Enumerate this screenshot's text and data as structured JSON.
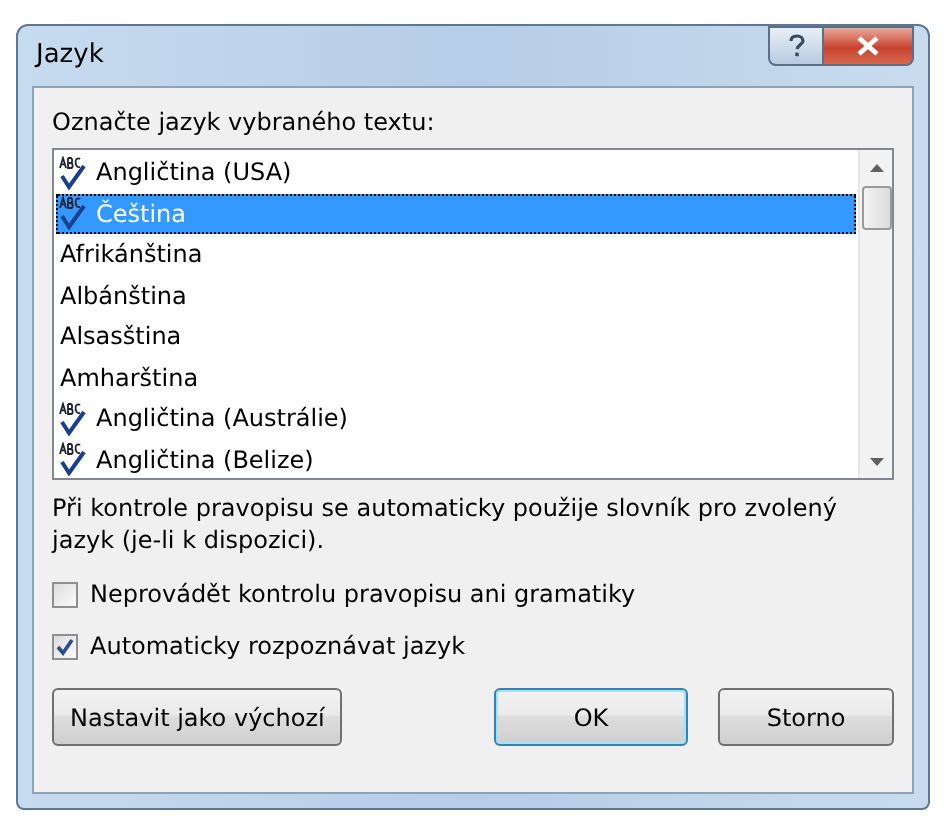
{
  "window": {
    "title": "Jazyk"
  },
  "list_label": "Označte jazyk vybraného textu:",
  "languages": [
    {
      "label": "Angličtina (USA)",
      "proofing": true,
      "selected": false
    },
    {
      "label": "Čeština",
      "proofing": true,
      "selected": true
    },
    {
      "label": "Afrikánština",
      "proofing": false,
      "selected": false
    },
    {
      "label": "Albánština",
      "proofing": false,
      "selected": false
    },
    {
      "label": "Alsasština",
      "proofing": false,
      "selected": false
    },
    {
      "label": "Amharština",
      "proofing": false,
      "selected": false
    },
    {
      "label": "Angličtina (Austrálie)",
      "proofing": true,
      "selected": false
    },
    {
      "label": "Angličtina (Belize)",
      "proofing": true,
      "selected": false
    }
  ],
  "note": "Při kontrole pravopisu se automaticky použije slovník pro zvolený jazyk (je-li k dispozici).",
  "options": [
    {
      "label": "Neprovádět kontrolu pravopisu ani gramatiky",
      "checked": false
    },
    {
      "label": "Automaticky rozpoznávat jazyk",
      "checked": true
    }
  ],
  "buttons": [
    {
      "label": "Nastavit jako výchozí",
      "kind": "default-setter"
    },
    {
      "label": "OK",
      "kind": "primary"
    },
    {
      "label": "Storno",
      "kind": "normal"
    }
  ]
}
